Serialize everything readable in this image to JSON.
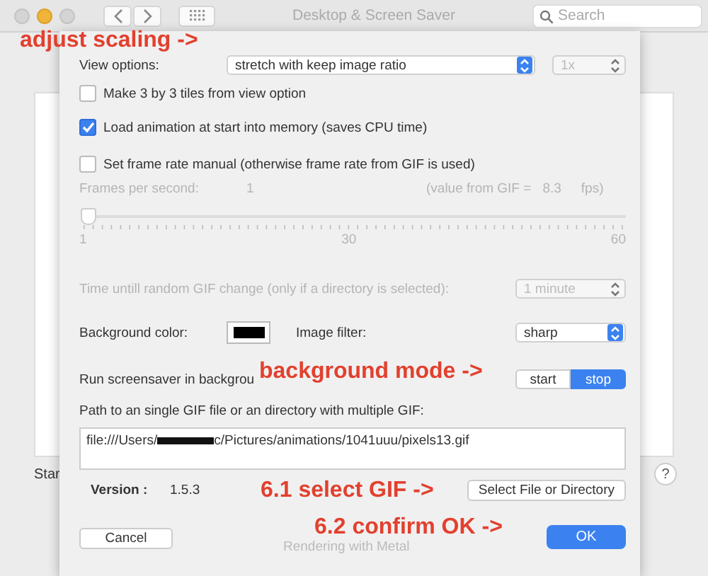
{
  "window": {
    "title": "Desktop & Screen Saver",
    "search": {
      "placeholder": "Search"
    },
    "background_label": "Star",
    "help_button": "?"
  },
  "sheet": {
    "view_options": {
      "label": "View options:",
      "value": "stretch with keep image ratio",
      "scale": {
        "value": "1x",
        "disabled": true
      }
    },
    "checkboxes": [
      {
        "label": "Make 3 by 3 tiles from view option",
        "checked": false
      },
      {
        "label": "Load animation at start into memory (saves CPU time)",
        "checked": true
      },
      {
        "label": "Set frame rate manual (otherwise frame rate from GIF is used)",
        "checked": false
      }
    ],
    "frames": {
      "disabled": true,
      "label": "Frames per second:",
      "value": "1",
      "gif_label": "(value from GIF =",
      "gif_value": "8.3",
      "unit": "fps)",
      "slider": {
        "level": 0,
        "ticks": [
          "1",
          "30",
          "60"
        ]
      }
    },
    "random_change": {
      "disabled": true,
      "label": "Time untill random GIF change (only if a directory is selected):",
      "value": "1 minute"
    },
    "background": {
      "label": "Background color:",
      "color": "#000000"
    },
    "filter": {
      "label": "Image filter:",
      "value": "sharp"
    },
    "run_mode": {
      "label": "Run screensaver in backgrou",
      "options": [
        {
          "label": "start",
          "selected": false
        },
        {
          "label": "stop",
          "selected": true
        }
      ]
    },
    "path": {
      "label": "Path to an single GIF file or an directory with multiple GIF:",
      "prefix": "file:///Users/",
      "redacted": true,
      "suffix": "c/Pictures/animations/1041uuu/pixels13.gif"
    },
    "version": {
      "label": "Version :",
      "value": "1.5.3"
    },
    "select_button": "Select File or Directory",
    "cancel_button": "Cancel",
    "status": "Rendering with Metal",
    "ok_button": "OK"
  },
  "annotations": [
    {
      "kind": "scaling",
      "text": "adjust scaling ->"
    },
    {
      "kind": "mode",
      "text": "background mode ->"
    },
    {
      "kind": "select",
      "text": "6.1 select GIF ->"
    },
    {
      "kind": "confirm",
      "text": "6.2 confirm OK ->"
    }
  ]
}
